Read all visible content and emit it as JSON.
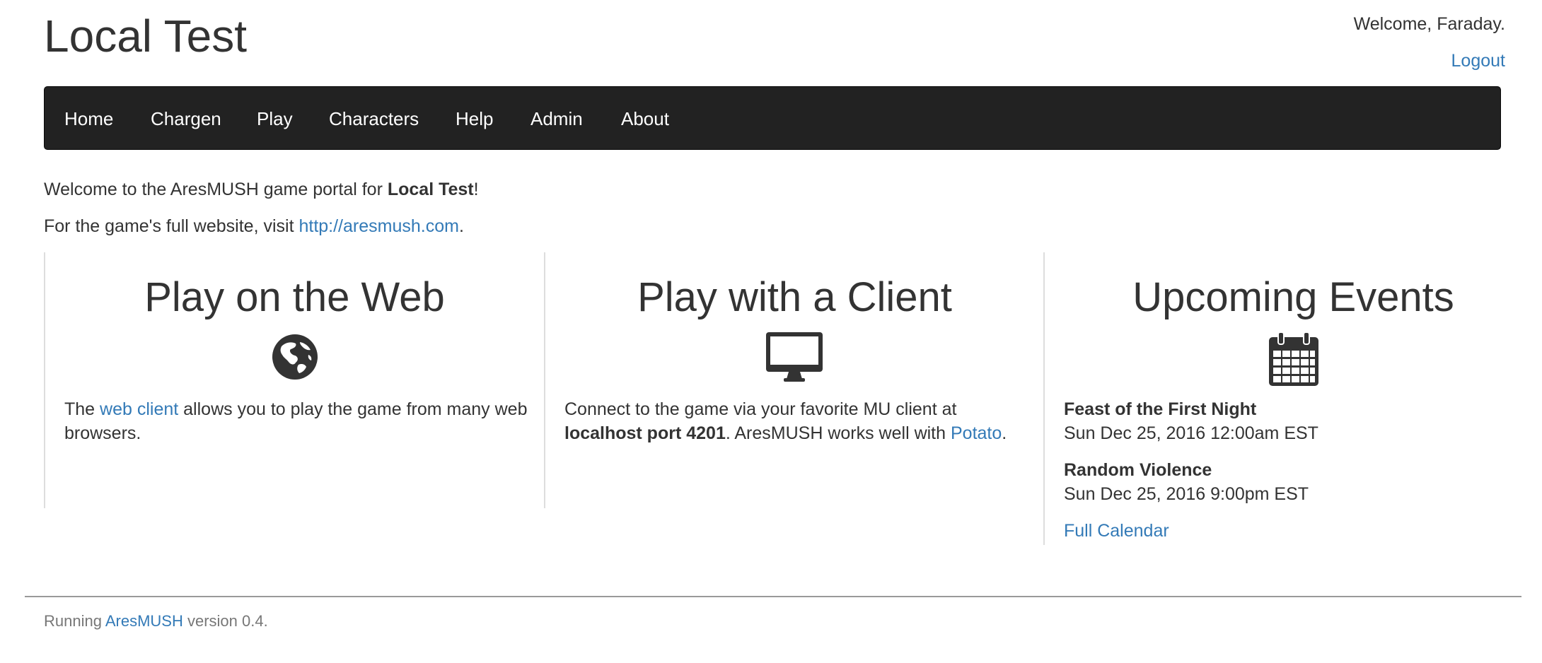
{
  "site": {
    "title": "Local Test",
    "welcome": "Welcome, Faraday.",
    "logout": "Logout"
  },
  "nav": {
    "items": [
      {
        "label": "Home"
      },
      {
        "label": "Chargen"
      },
      {
        "label": "Play"
      },
      {
        "label": "Characters"
      },
      {
        "label": "Help"
      },
      {
        "label": "Admin"
      },
      {
        "label": "About"
      }
    ]
  },
  "intro": {
    "line1_prefix": "Welcome to the AresMUSH game portal for ",
    "line1_game": "Local Test",
    "line1_suffix": "!",
    "line2_prefix": "For the game's full website, visit ",
    "line2_link": "http://aresmush.com",
    "line2_suffix": "."
  },
  "panels": {
    "web": {
      "title": "Play on the Web",
      "icon": "globe-icon",
      "text_prefix": "The ",
      "link": "web client",
      "text_suffix": " allows you to play the game from many web browsers."
    },
    "client": {
      "title": "Play with a Client",
      "icon": "monitor-icon",
      "text_prefix": "Connect to the game via your favorite MU client at ",
      "address": "localhost port 4201",
      "text_middle": ". AresMUSH works well with ",
      "link": "Potato",
      "text_suffix": "."
    },
    "events": {
      "title": "Upcoming Events",
      "icon": "calendar-icon",
      "items": [
        {
          "name": "Feast of the First Night",
          "date": "Sun Dec 25, 2016 12:00am EST"
        },
        {
          "name": "Random Violence",
          "date": "Sun Dec 25, 2016 9:00pm EST"
        }
      ],
      "calendar_link": "Full Calendar"
    }
  },
  "footer": {
    "prefix": "Running ",
    "link": "AresMUSH",
    "suffix": " version 0.4."
  },
  "colors": {
    "navbar_bg": "#222222",
    "link": "#337ab7",
    "text": "#333333",
    "muted": "#777777"
  }
}
